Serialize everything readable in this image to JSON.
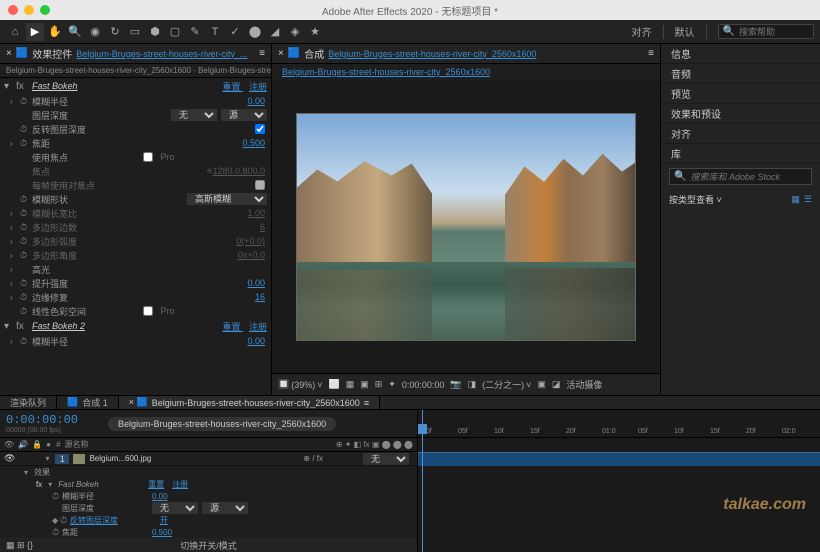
{
  "title": "Adobe After Effects 2020 - 无标题项目 *",
  "toolbar": {
    "workspace_label_1": "对齐",
    "workspace_label_2": "默认",
    "search_placeholder": "搜索帮助"
  },
  "effects_panel": {
    "tab_label": "效果控件",
    "tab_sub": "Belgium-Bruges-street-houses-river-city_...",
    "breadcrumb": "Belgium-Bruges-street-houses-river-city_2560x1600 · Belgium-Bruges-street-hou",
    "fx1": {
      "name": "Fast Bokeh",
      "reset": "重置",
      "register": "注册"
    },
    "props": {
      "blur_radius": "模糊半径",
      "blur_radius_val": "0.00",
      "layer_depth": "图层深度",
      "layer_none": "无",
      "layer_source": "源",
      "invert_depth": "反转图层深度",
      "focus": "焦距",
      "focus_val": "0.500",
      "use_focus": "使用焦点",
      "pro_label": "Pro",
      "focus_point": "焦点",
      "focus_point_val": "1280.0,800.0",
      "always_focus": "每帧使用对焦点",
      "blur_shape": "模糊形状",
      "blur_shape_val": "高斯模糊",
      "blur_aspect": "模糊长宽比",
      "blur_aspect_val": "1.00",
      "poly_edges": "多边形边数",
      "poly_edges_val": "6",
      "poly_curve": "多边形弧度",
      "poly_curve_val": "0(+0.0)",
      "poly_angle": "多边形角度",
      "poly_angle_val": "0x+0.0",
      "highlight": "高光",
      "boost": "提升强度",
      "boost_val": "0.00",
      "edge_fix": "边缘修复",
      "edge_fix_val": "16",
      "linear_color": "线性色彩空间"
    },
    "fx2": {
      "name": "Fast Bokeh 2",
      "reset": "重置",
      "register": "注册",
      "blur_radius": "模糊半径",
      "blur_radius_val": "0.00"
    }
  },
  "comp_panel": {
    "tab_type": "合成",
    "comp_name": "Belgium-Bruges-street-houses-river-city_2560x1600",
    "sub_name": "Belgium-Bruges-street-houses-river-city_2560x1600"
  },
  "viewer_controls": {
    "zoom": "(39%)",
    "timecode": "0:00:00:00",
    "resolution": "(二分之一)",
    "camera": "活动摄像"
  },
  "right_panel": {
    "items": [
      "信息",
      "音频",
      "预览",
      "效果和预设",
      "对齐",
      "库"
    ],
    "stock_placeholder": "搜索库和 Adobe Stock",
    "browse_label": "按类型查看"
  },
  "timeline": {
    "tab_render": "渲染队列",
    "tab_comp1": "合成 1",
    "tab_comp2": "Belgium-Bruges-street-houses-river-city_2560x1600",
    "timecode": "0:00:00:00",
    "timecode_sub": "00000 (00.00 fps)",
    "layer_bar": "Belgium-Bruges-street-houses-river-city_2560x1600",
    "col_source": "源名称",
    "layer1_name": "Belgium...600.jpg",
    "switch_none": "无",
    "effect_label": "效果",
    "fx_name": "Fast Bokeh",
    "fx_reset": "重置",
    "fx_register": "注册",
    "blur_radius": "模糊半径",
    "blur_radius_val": "0.00",
    "layer_depth": "图层深度",
    "layer_none": "无",
    "layer_source": "源",
    "invert_depth": "反转图层深度",
    "invert_on": "开",
    "focus": "焦距",
    "focus_val": "0.500",
    "footer": "切换开关/模式",
    "ruler": [
      "00f",
      "05f",
      "10f",
      "15f",
      "20f",
      "01:0",
      "05f",
      "10f",
      "15f",
      "20f",
      "02:0"
    ]
  },
  "watermark": "talkae.com"
}
